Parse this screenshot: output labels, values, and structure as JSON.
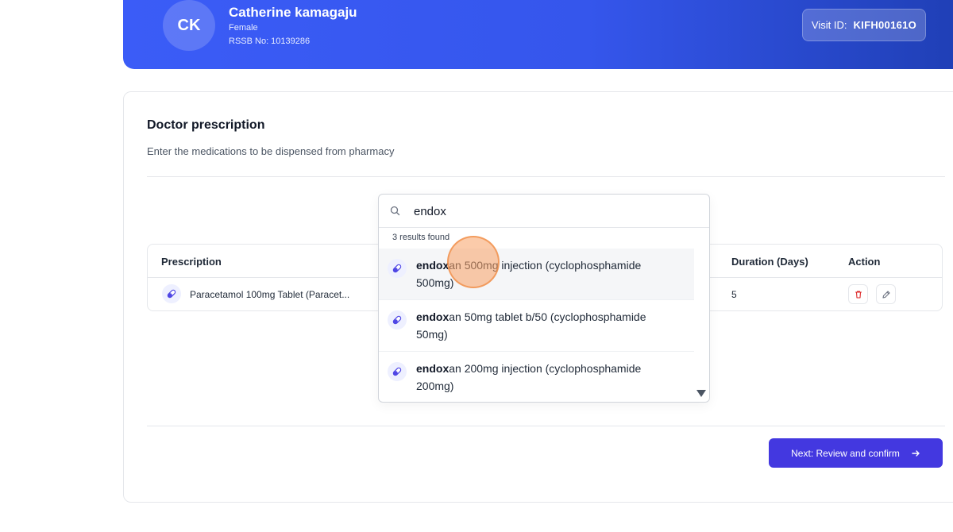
{
  "patient": {
    "initials": "CK",
    "name": "Catherine kamagaju",
    "gender": "Female",
    "rssb": "RSSB No: 10139286",
    "visit_label": "Visit ID:",
    "visit_id": "KIFH00161O"
  },
  "section": {
    "title": "Doctor prescription",
    "subtitle": "Enter the medications to be dispensed from pharmacy"
  },
  "table": {
    "headers": {
      "prescription": "Prescription",
      "duration": "Duration (Days)",
      "action": "Action"
    },
    "rows": [
      {
        "name": "Paracetamol 100mg Tablet (Paracet...",
        "duration": "5"
      }
    ]
  },
  "search": {
    "query": "endox",
    "results_count": "3 results found",
    "results": [
      {
        "match": "endox",
        "rest": "an 500mg injection (cyclophosphamide 500mg)"
      },
      {
        "match": "endox",
        "rest": "an 50mg tablet b/50 (cyclophosphamide 50mg)"
      },
      {
        "match": "endox",
        "rest": "an 200mg injection (cyclophosphamide 200mg)"
      }
    ]
  },
  "actions": {
    "next_label": "Next: Review and confirm",
    "next_icon": "arrow-right-icon"
  },
  "colors": {
    "header_start": "#3b5cf7",
    "header_end": "#1f3fb5",
    "primary_button": "#4338e0",
    "delete_icon": "#dc2626"
  }
}
